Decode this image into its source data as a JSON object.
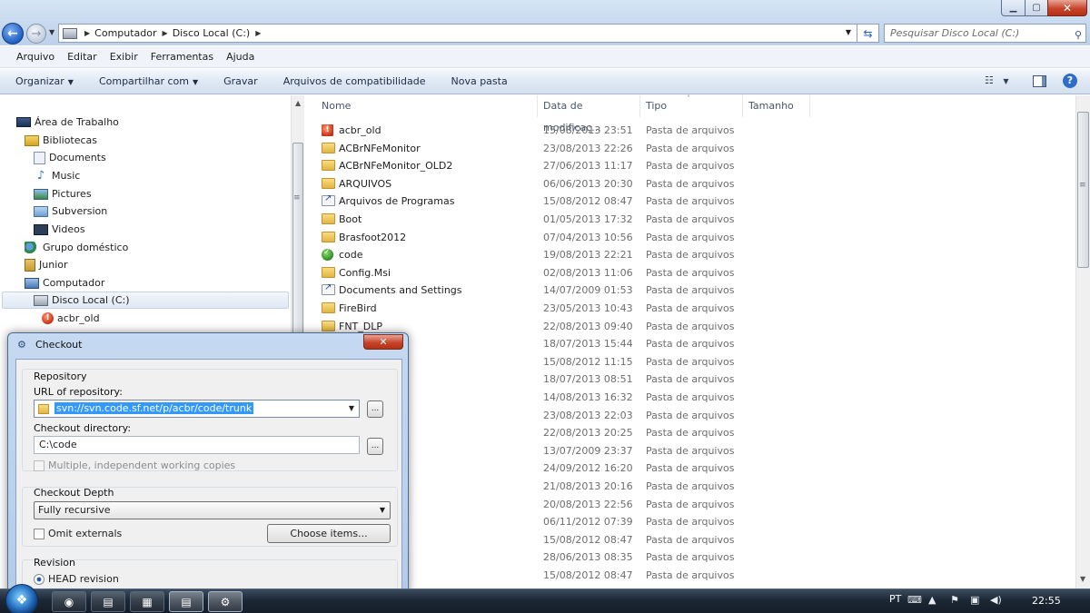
{
  "window": {
    "minimize_glyph": "▁",
    "maximize_glyph": "▢",
    "close_glyph": "✕"
  },
  "address": {
    "crumbs": [
      "Computador",
      "Disco Local (C:)"
    ],
    "search_placeholder": "Pesquisar Disco Local (C:)"
  },
  "menubar": {
    "items": [
      "Arquivo",
      "Editar",
      "Exibir",
      "Ferramentas",
      "Ajuda"
    ]
  },
  "commandbar": {
    "organize": "Organizar",
    "share": "Compartilhar com",
    "burn": "Gravar",
    "compat": "Arquivos de compatibilidade",
    "new_folder": "Nova pasta"
  },
  "navpane": {
    "items": [
      {
        "label": "Área de Trabalho",
        "icon": "desktop-icon"
      },
      {
        "label": "Bibliotecas",
        "icon": "libraries-icon"
      },
      {
        "label": "Documents",
        "icon": "documents-icon"
      },
      {
        "label": "Music",
        "icon": "music-icon"
      },
      {
        "label": "Pictures",
        "icon": "pictures-icon"
      },
      {
        "label": "Subversion",
        "icon": "subversion-icon"
      },
      {
        "label": "Videos",
        "icon": "videos-icon"
      },
      {
        "label": "Grupo doméstico",
        "icon": "homegroup-icon"
      },
      {
        "label": "Junior",
        "icon": "user-folder-icon"
      },
      {
        "label": "Computador",
        "icon": "computer-icon"
      },
      {
        "label": "Disco Local (C:)",
        "icon": "drive-icon"
      },
      {
        "label": "acbr_old",
        "icon": "svn-conflict-icon"
      }
    ]
  },
  "filelist": {
    "columns": [
      "Nome",
      "Data de modificaç...",
      "Tipo",
      "Tamanho"
    ],
    "rows": [
      {
        "name": "acbr_old",
        "date": "15/08/2013 23:51",
        "type": "Pasta de arquivos",
        "icon": "svn-conflict-icon"
      },
      {
        "name": "ACBrNFeMonitor",
        "date": "23/08/2013 22:26",
        "type": "Pasta de arquivos",
        "icon": "folder-icon"
      },
      {
        "name": "ACBrNFeMonitor_OLD2",
        "date": "27/06/2013 11:17",
        "type": "Pasta de arquivos",
        "icon": "folder-icon"
      },
      {
        "name": "ARQUIVOS",
        "date": "06/06/2013 20:30",
        "type": "Pasta de arquivos",
        "icon": "folder-icon"
      },
      {
        "name": "Arquivos de Programas",
        "date": "15/08/2012 08:47",
        "type": "Pasta de arquivos",
        "icon": "junction-icon"
      },
      {
        "name": "Boot",
        "date": "01/05/2013 17:32",
        "type": "Pasta de arquivos",
        "icon": "folder-icon"
      },
      {
        "name": "Brasfoot2012",
        "date": "07/04/2013 10:56",
        "type": "Pasta de arquivos",
        "icon": "folder-icon"
      },
      {
        "name": "code",
        "date": "19/08/2013 22:21",
        "type": "Pasta de arquivos",
        "icon": "svn-ok-icon"
      },
      {
        "name": "Config.Msi",
        "date": "02/08/2013 11:06",
        "type": "Pasta de arquivos",
        "icon": "folder-icon"
      },
      {
        "name": "Documents and Settings",
        "date": "14/07/2009 01:53",
        "type": "Pasta de arquivos",
        "icon": "junction-icon"
      },
      {
        "name": "FireBird",
        "date": "23/05/2013 10:43",
        "type": "Pasta de arquivos",
        "icon": "folder-icon"
      },
      {
        "name": "FNT_DLP",
        "date": "22/08/2013 09:40",
        "type": "Pasta de arquivos",
        "icon": "folder-icon"
      },
      {
        "name": "",
        "date": "18/07/2013 15:44",
        "type": "Pasta de arquivos",
        "icon": "folder-icon"
      },
      {
        "name": "",
        "date": "15/08/2012 11:15",
        "type": "Pasta de arquivos",
        "icon": "folder-icon"
      },
      {
        "name": "",
        "date": "18/07/2013 08:51",
        "type": "Pasta de arquivos",
        "icon": "folder-icon"
      },
      {
        "name": "",
        "date": "14/08/2013 16:32",
        "type": "Pasta de arquivos",
        "icon": "folder-icon"
      },
      {
        "name": "",
        "date": "23/08/2013 22:03",
        "type": "Pasta de arquivos",
        "icon": "folder-icon"
      },
      {
        "name": "",
        "date": "22/08/2013 20:25",
        "type": "Pasta de arquivos",
        "icon": "folder-icon"
      },
      {
        "name": "",
        "date": "13/07/2009 23:37",
        "type": "Pasta de arquivos",
        "icon": "folder-icon"
      },
      {
        "name": "",
        "date": "24/09/2012 16:20",
        "type": "Pasta de arquivos",
        "icon": "folder-icon"
      },
      {
        "name": "",
        "date": "21/08/2013 20:16",
        "type": "Pasta de arquivos",
        "icon": "folder-icon"
      },
      {
        "name": "",
        "date": "20/08/2013 22:56",
        "type": "Pasta de arquivos",
        "icon": "folder-icon"
      },
      {
        "name": "",
        "date": "06/11/2012 07:39",
        "type": "Pasta de arquivos",
        "icon": "folder-icon"
      },
      {
        "name": "",
        "date": "15/08/2012 08:47",
        "type": "Pasta de arquivos",
        "icon": "folder-icon"
      },
      {
        "name": "",
        "date": "28/06/2013 08:35",
        "type": "Pasta de arquivos",
        "icon": "folder-icon"
      },
      {
        "name": "",
        "date": "15/08/2012 08:47",
        "type": "Pasta de arquivos",
        "icon": "folder-icon"
      }
    ]
  },
  "dialog": {
    "title": "Checkout",
    "repository_group": "Repository",
    "url_label": "URL of repository:",
    "url_value": "svn://svn.code.sf.net/p/acbr/code/trunk",
    "dir_label": "Checkout directory:",
    "dir_value": "C:\\code",
    "browse_label": "...",
    "multiple_label": "Multiple, independent working copies",
    "depth_group": "Checkout Depth",
    "depth_value": "Fully recursive",
    "omit_externals": "Omit externals",
    "choose_items": "Choose items...",
    "revision_group": "Revision",
    "head_revision": "HEAD revision"
  },
  "taskbar": {
    "lang": "PT",
    "clock": "22:55"
  }
}
